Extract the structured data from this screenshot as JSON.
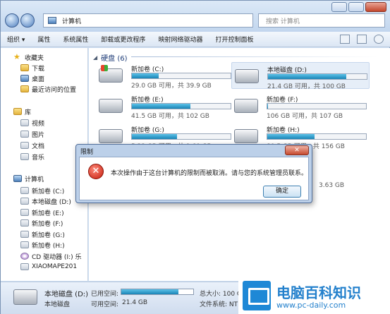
{
  "window": {
    "address_crumb": "计算机",
    "search_placeholder": "搜索 计算机"
  },
  "toolbar": {
    "organize": "组织 ▾",
    "properties": "属性",
    "system_properties": "系统属性",
    "uninstall": "卸载或更改程序",
    "map_drive": "映射网络驱动器",
    "control_panel": "打开控制面板"
  },
  "sidebar": {
    "favorites": "收藏夹",
    "fav_items": [
      "下载",
      "桌面",
      "最近访问的位置"
    ],
    "libraries": "库",
    "lib_items": [
      "视频",
      "图片",
      "文档",
      "音乐"
    ],
    "computer": "计算机",
    "comp_items": [
      "新加卷 (C:)",
      "本地磁盘 (D:)",
      "新加卷 (E:)",
      "新加卷 (F:)",
      "新加卷 (G:)",
      "新加卷 (H:)",
      "CD 驱动器 (I:) 乐",
      "XIAOMAPE201"
    ]
  },
  "content": {
    "group_title": "硬盘 (6)",
    "drives": [
      {
        "name": "新加卷 (C:)",
        "info": "29.0 GB 可用，共 39.9 GB",
        "used": 0.27
      },
      {
        "name": "本地磁盘 (D:)",
        "info": "21.4 GB 可用，共 100 GB",
        "used": 0.79
      },
      {
        "name": "新加卷 (E:)",
        "info": "41.5 GB 可用，共 102 GB",
        "used": 0.59
      },
      {
        "name": "新加卷 (F:)",
        "info": "106 GB 可用，共 107 GB",
        "used": 0.01
      },
      {
        "name": "新加卷 (G:)",
        "info": "5.23 GB 可用，共 9.60 GB",
        "used": 0.46
      },
      {
        "name": "新加卷 (H:)",
        "info": "80.5 GB 可用，共 156 GB",
        "used": 0.48
      }
    ],
    "partial_info": "3.63 GB"
  },
  "details": {
    "name": "本地磁盘 (D:)",
    "type": "本地磁盘",
    "used_label": "已用空间:",
    "free_label": "可用空间:",
    "free_value": "21.4 GB",
    "total_label": "总大小: 100 GB",
    "fs_label": "文件系统: NTFS",
    "used_fraction": 0.79
  },
  "dialog": {
    "title": "限制",
    "close": "✕",
    "message": "本次操作由于这台计算机的限制而被取消。请与您的系统管理员联系。",
    "ok": "确定"
  },
  "watermark": {
    "brand": "电脑百科知识",
    "url": "www.pc-daily.com"
  },
  "colors": {
    "accent": "#1e88d6",
    "bar_fill": "#1a84b5",
    "error_red": "#c41c0c"
  }
}
